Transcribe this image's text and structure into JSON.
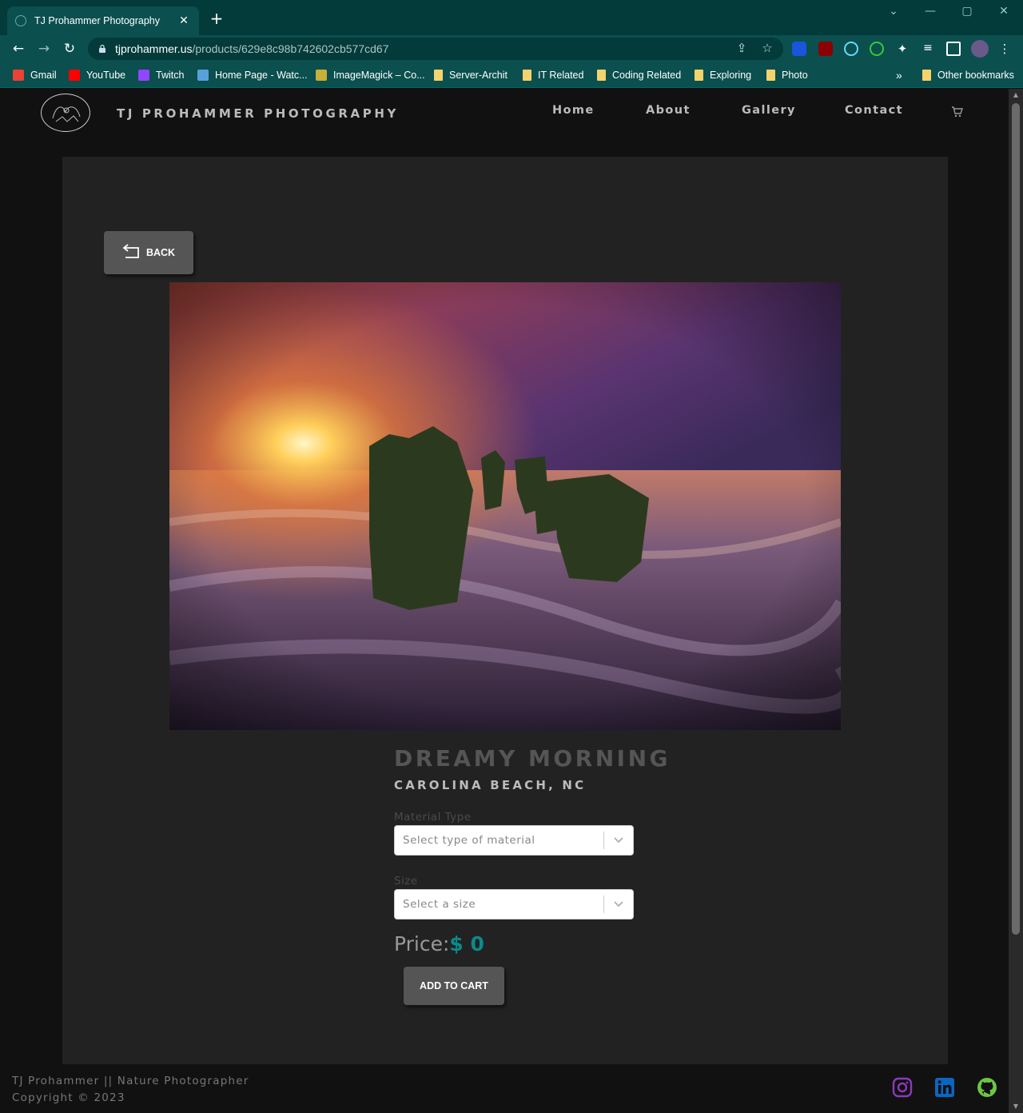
{
  "browser": {
    "tab_title": "TJ Prohammer Photography",
    "tab_close": "✕",
    "new_tab": "+",
    "url_host": "tjprohammer.us",
    "url_path": "/products/629e8c98b742602cb577cd67",
    "bookmarks": [
      {
        "label": "Gmail",
        "icon": "gmail-icon"
      },
      {
        "label": "YouTube",
        "icon": "youtube-icon"
      },
      {
        "label": "Twitch",
        "icon": "twitch-icon"
      },
      {
        "label": "Home Page - Watc...",
        "icon": "site-icon"
      },
      {
        "label": "ImageMagick – Co...",
        "icon": "wand-icon"
      },
      {
        "label": "Server-Archit",
        "icon": "folder-icon"
      },
      {
        "label": "IT Related",
        "icon": "folder-icon"
      },
      {
        "label": "Coding Related",
        "icon": "folder-icon"
      },
      {
        "label": "Exploring",
        "icon": "folder-icon"
      },
      {
        "label": "Photo",
        "icon": "folder-icon"
      }
    ],
    "bookmarks_overflow": "»",
    "other_bookmarks": "Other bookmarks"
  },
  "site": {
    "brand": "TJ PROHAMMER PHOTOGRAPHY",
    "nav": [
      "Home",
      "About",
      "Gallery",
      "Contact"
    ]
  },
  "product": {
    "back_label": "BACK",
    "title": "DREAMY MORNING",
    "location": "CAROLINA BEACH, NC",
    "material_label": "Material Type",
    "material_placeholder": "Select type of material",
    "size_label": "Size",
    "size_placeholder": "Select a size",
    "price_label": "Price:",
    "price_value": "$ 0",
    "add_to_cart": "ADD TO CART"
  },
  "footer": {
    "line1": "TJ Prohammer || Nature Photographer",
    "line2": "Copyright © 2023"
  },
  "colors": {
    "tab_bg": "#033a3a",
    "toolbar_bg": "#0b4f4f",
    "panel_bg": "#222222",
    "accent": "#0b8a8a",
    "instagram": "#8a3ab9",
    "linkedin": "#0a66c2",
    "github": "#6cc644"
  }
}
